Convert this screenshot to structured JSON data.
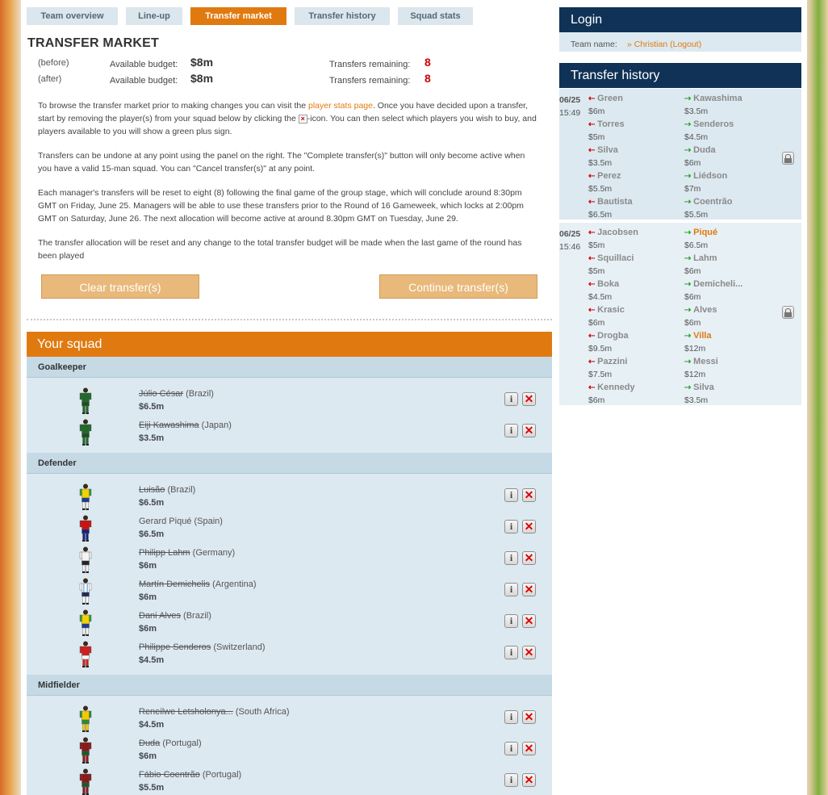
{
  "tabs": [
    {
      "label": "Team overview",
      "active": false
    },
    {
      "label": "Line-up",
      "active": false
    },
    {
      "label": "Transfer market",
      "active": true
    },
    {
      "label": "Transfer history",
      "active": false
    },
    {
      "label": "Squad stats",
      "active": false
    }
  ],
  "title": "TRANSFER MARKET",
  "budget": {
    "before": {
      "tag": "(before)",
      "label": "Available budget:",
      "amount": "$8m",
      "transfers_label": "Transfers remaining:",
      "transfers": "8"
    },
    "after": {
      "tag": "(after)",
      "label": "Available budget:",
      "amount": "$8m",
      "transfers_label": "Transfers remaining:",
      "transfers": "8"
    }
  },
  "paragraphs": {
    "p1_a": "To browse the transfer market prior to making changes you can visit the ",
    "p1_link": "player stats page",
    "p1_b": ". Once you have decided upon a transfer, start by removing the player(s) from your squad below by clicking the ",
    "p1_c": "-icon. You can then select which players you wish to buy, and players available to you will show a green plus sign.",
    "p2": "Transfers can be undone at any point using the panel on the right. The \"Complete transfer(s)\" button will only become active when you have a valid 15-man squad. You can \"Cancel transfer(s)\" at any point.",
    "p3": "Each manager's transfers will be reset to eight (8) following the final game of the group stage, which will conclude around 8:30pm GMT on Friday, June 25. Managers will be able to use these transfers prior to the Round of 16 Gameweek, which locks at 2:00pm GMT on Saturday, June 26. The next allocation will become active at around 8.30pm GMT on Tuesday, June 29.",
    "p4": "The transfer allocation will be reset and any change to the total transfer budget will be made when the last game of the round has been played"
  },
  "buttons": {
    "clear": "Clear transfer(s)",
    "continue": "Continue transfer(s)"
  },
  "squad": {
    "title": "Your squad",
    "positions": {
      "gk": "Goalkeeper",
      "def": "Defender",
      "mid": "Midfielder"
    },
    "players": [
      {
        "name": "Júlio César",
        "country": "(Brazil)",
        "price": "$6.5m",
        "removed": true,
        "kit": "gk"
      },
      {
        "name": "Eiji Kawashima",
        "country": "(Japan)",
        "price": "$3.5m",
        "removed": true,
        "kit": "gk"
      },
      {
        "name": "Luisão",
        "country": "(Brazil)",
        "price": "$6.5m",
        "removed": true,
        "kit": "brazil"
      },
      {
        "name": "Gerard Piqué",
        "country": "(Spain)",
        "price": "$6.5m",
        "removed": false,
        "kit": "spain"
      },
      {
        "name": "Philipp Lahm",
        "country": "(Germany)",
        "price": "$6m",
        "removed": true,
        "kit": "germany"
      },
      {
        "name": "Martín Demichelis",
        "country": "(Argentina)",
        "price": "$6m",
        "removed": true,
        "kit": "argentina"
      },
      {
        "name": "Dani Alves",
        "country": "(Brazil)",
        "price": "$6m",
        "removed": true,
        "kit": "brazil"
      },
      {
        "name": "Philippe Senderos",
        "country": "(Switzerland)",
        "price": "$4.5m",
        "removed": true,
        "kit": "swiss"
      },
      {
        "name": "Reneilwe Letsholonya...",
        "country": "(South Africa)",
        "price": "$4.5m",
        "removed": true,
        "kit": "rsa"
      },
      {
        "name": "Duda",
        "country": "(Portugal)",
        "price": "$6m",
        "removed": true,
        "kit": "portugal"
      },
      {
        "name": "Fábio Coentrão",
        "country": "(Portugal)",
        "price": "$5.5m",
        "removed": true,
        "kit": "portugal"
      }
    ],
    "info_glyph": "i",
    "remove_glyph": "✕"
  },
  "login": {
    "title": "Login",
    "team_label": "Team name:",
    "team_value": "» Christian (Logout)"
  },
  "history": {
    "title": "Transfer history",
    "groups": [
      {
        "date": "06/25",
        "time": "15:49",
        "rows": [
          {
            "out": "Green",
            "out_price": "$6m",
            "in": "Kawashima",
            "in_price": "$3.5m",
            "in_hl": false
          },
          {
            "out": "Torres",
            "out_price": "$5m",
            "in": "Senderos",
            "in_price": "$4.5m",
            "in_hl": false
          },
          {
            "out": "Silva",
            "out_price": "$3.5m",
            "in": "Duda",
            "in_price": "$6m",
            "in_hl": false
          },
          {
            "out": "Perez",
            "out_price": "$5.5m",
            "in": "Liédson",
            "in_price": "$7m",
            "in_hl": false
          },
          {
            "out": "Bautista",
            "out_price": "$6.5m",
            "in": "Coentrão",
            "in_price": "$5.5m",
            "in_hl": false
          }
        ]
      },
      {
        "date": "06/25",
        "time": "15:46",
        "rows": [
          {
            "out": "Jacobsen",
            "out_price": "$5m",
            "in": "Piqué",
            "in_price": "$6.5m",
            "in_hl": true
          },
          {
            "out": "Squillaci",
            "out_price": "$5m",
            "in": "Lahm",
            "in_price": "$6m",
            "in_hl": false
          },
          {
            "out": "Boka",
            "out_price": "$4.5m",
            "in": "Demicheli...",
            "in_price": "$6m",
            "in_hl": false
          },
          {
            "out": "Krasic",
            "out_price": "$6m",
            "in": "Alves",
            "in_price": "$6m",
            "in_hl": false
          },
          {
            "out": "Drogba",
            "out_price": "$9.5m",
            "in": "Villa",
            "in_price": "$12m",
            "in_hl": true
          },
          {
            "out": "Pazzini",
            "out_price": "$7.5m",
            "in": "Messi",
            "in_price": "$12m",
            "in_hl": false
          },
          {
            "out": "Kennedy",
            "out_price": "$6m",
            "in": "Silva",
            "in_price": "$3.5m",
            "in_hl": false
          }
        ]
      }
    ]
  },
  "colors": {
    "accent": "#e07a10",
    "navy": "#0f3256",
    "panel": "#dce9f0",
    "red": "#cc0000"
  }
}
